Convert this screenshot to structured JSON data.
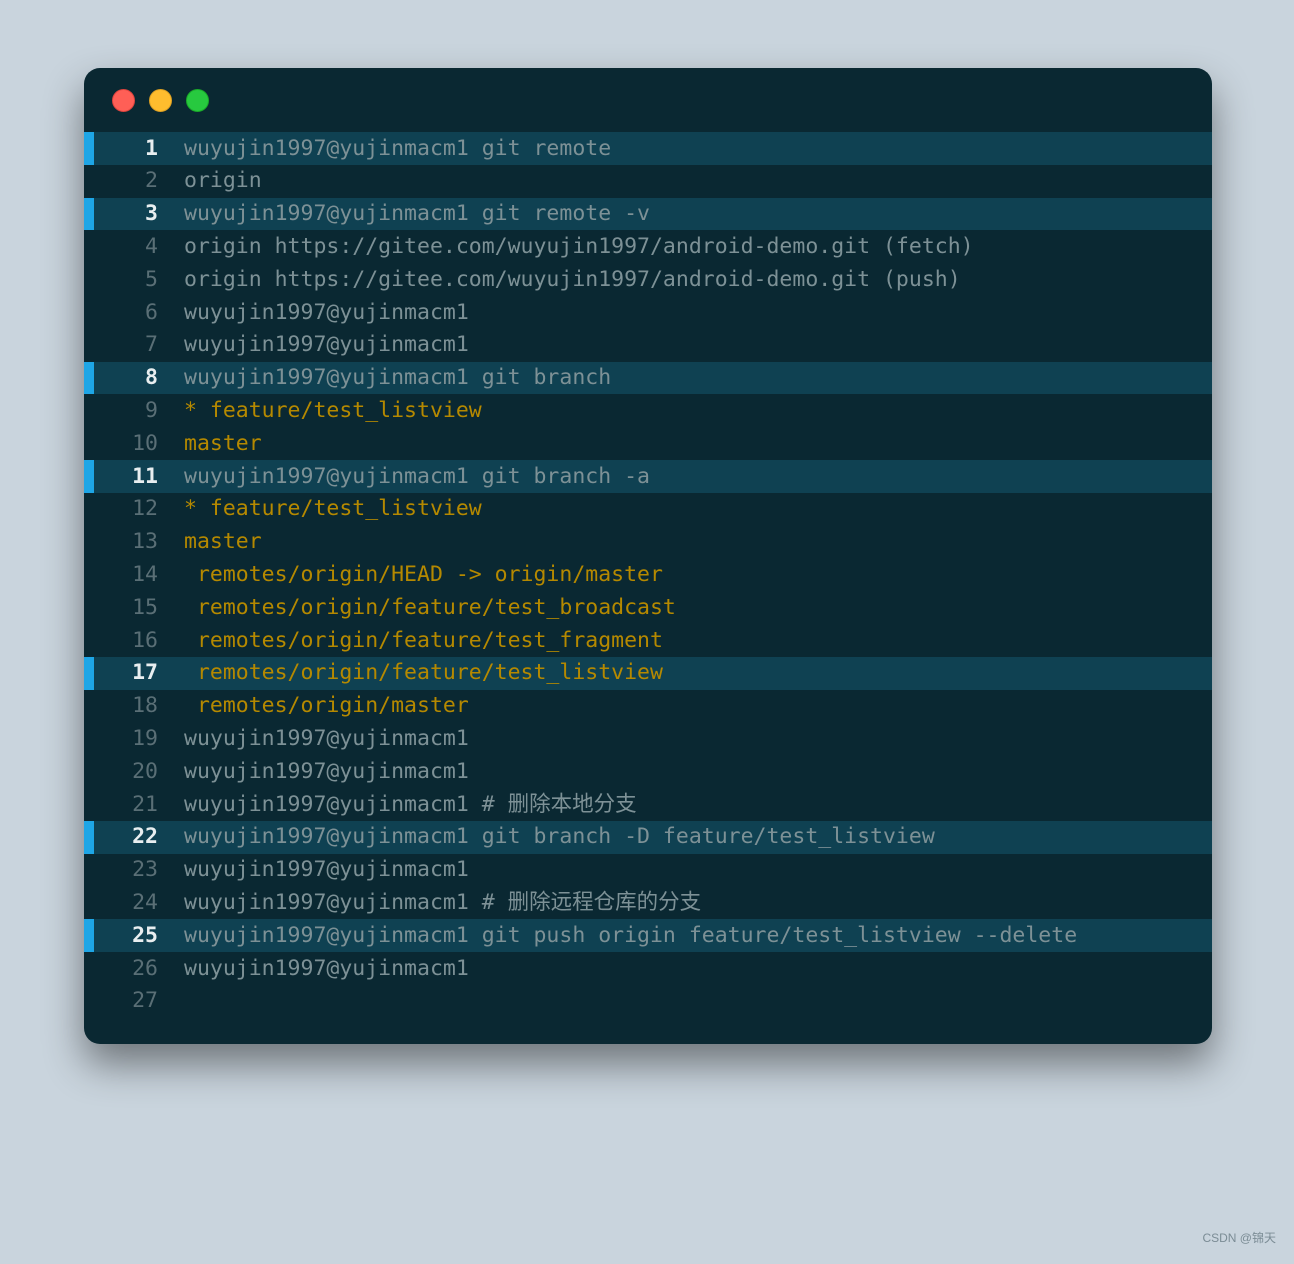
{
  "window": {
    "close": "close",
    "minimize": "minimize",
    "maximize": "maximize"
  },
  "lines": [
    {
      "n": "1",
      "hl": true,
      "color": "",
      "text": "wuyujin1997@yujinmacm1 git remote"
    },
    {
      "n": "2",
      "hl": false,
      "color": "",
      "text": "origin"
    },
    {
      "n": "3",
      "hl": true,
      "color": "",
      "text": "wuyujin1997@yujinmacm1 git remote -v"
    },
    {
      "n": "4",
      "hl": false,
      "color": "",
      "text": "origin https://gitee.com/wuyujin1997/android-demo.git (fetch)"
    },
    {
      "n": "5",
      "hl": false,
      "color": "",
      "text": "origin https://gitee.com/wuyujin1997/android-demo.git (push)"
    },
    {
      "n": "6",
      "hl": false,
      "color": "",
      "text": "wuyujin1997@yujinmacm1"
    },
    {
      "n": "7",
      "hl": false,
      "color": "",
      "text": "wuyujin1997@yujinmacm1"
    },
    {
      "n": "8",
      "hl": true,
      "color": "",
      "text": "wuyujin1997@yujinmacm1 git branch"
    },
    {
      "n": "9",
      "hl": false,
      "color": "yellow",
      "text": "* feature/test_listview"
    },
    {
      "n": "10",
      "hl": false,
      "color": "yellow",
      "text": "master"
    },
    {
      "n": "11",
      "hl": true,
      "color": "",
      "text": "wuyujin1997@yujinmacm1 git branch -a"
    },
    {
      "n": "12",
      "hl": false,
      "color": "yellow",
      "text": "* feature/test_listview"
    },
    {
      "n": "13",
      "hl": false,
      "color": "yellow",
      "text": "master"
    },
    {
      "n": "14",
      "hl": false,
      "color": "yellow",
      "text": " remotes/origin/HEAD -> origin/master"
    },
    {
      "n": "15",
      "hl": false,
      "color": "yellow",
      "text": " remotes/origin/feature/test_broadcast"
    },
    {
      "n": "16",
      "hl": false,
      "color": "yellow",
      "text": " remotes/origin/feature/test_fragment"
    },
    {
      "n": "17",
      "hl": true,
      "color": "yellow",
      "text": " remotes/origin/feature/test_listview"
    },
    {
      "n": "18",
      "hl": false,
      "color": "yellow",
      "text": " remotes/origin/master"
    },
    {
      "n": "19",
      "hl": false,
      "color": "",
      "text": "wuyujin1997@yujinmacm1"
    },
    {
      "n": "20",
      "hl": false,
      "color": "",
      "text": "wuyujin1997@yujinmacm1"
    },
    {
      "n": "21",
      "hl": false,
      "color": "",
      "text": "wuyujin1997@yujinmacm1 # 删除本地分支"
    },
    {
      "n": "22",
      "hl": true,
      "color": "",
      "text": "wuyujin1997@yujinmacm1 git branch -D feature/test_listview"
    },
    {
      "n": "23",
      "hl": false,
      "color": "",
      "text": "wuyujin1997@yujinmacm1"
    },
    {
      "n": "24",
      "hl": false,
      "color": "",
      "text": "wuyujin1997@yujinmacm1 # 删除远程仓库的分支"
    },
    {
      "n": "25",
      "hl": true,
      "color": "",
      "text": "wuyujin1997@yujinmacm1 git push origin feature/test_listview --delete"
    },
    {
      "n": "26",
      "hl": false,
      "color": "",
      "text": "wuyujin1997@yujinmacm1"
    },
    {
      "n": "27",
      "hl": false,
      "color": "",
      "text": ""
    }
  ],
  "watermark": "CSDN @锦天"
}
